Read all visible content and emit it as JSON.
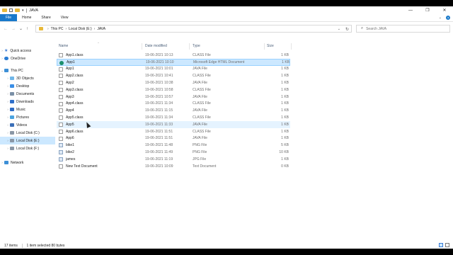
{
  "window": {
    "title": "JAVA",
    "quick_access_arrow": "▾",
    "controls": {
      "minimize": "—",
      "maximize": "❐",
      "close": "✕"
    }
  },
  "ribbon": {
    "tabs": [
      "File",
      "Home",
      "Share",
      "View"
    ],
    "expand": "⌄",
    "help": "?"
  },
  "address": {
    "crumbs": [
      "This PC",
      "Local Disk (E:)",
      "JAVA"
    ],
    "separator": "›"
  },
  "search": {
    "placeholder": "Search JAVA"
  },
  "navpane": {
    "items": [
      {
        "label": "Quick access",
        "icon": "star-icon"
      },
      {
        "label": "OneDrive",
        "icon": "cloud-icon"
      },
      {
        "label": "This PC",
        "icon": "computer-icon"
      },
      {
        "label": "3D Objects",
        "icon": "cube-icon"
      },
      {
        "label": "Desktop",
        "icon": "desktop-icon"
      },
      {
        "label": "Documents",
        "icon": "documents-icon"
      },
      {
        "label": "Downloads",
        "icon": "downloads-icon"
      },
      {
        "label": "Music",
        "icon": "music-icon"
      },
      {
        "label": "Pictures",
        "icon": "pictures-icon"
      },
      {
        "label": "Videos",
        "icon": "videos-icon"
      },
      {
        "label": "Local Disk (C:)",
        "icon": "drive-icon"
      },
      {
        "label": "Local Disk (E:)",
        "icon": "drive-icon"
      },
      {
        "label": "Local Disk (F:)",
        "icon": "drive-icon"
      },
      {
        "label": "Network",
        "icon": "network-icon"
      }
    ]
  },
  "columns": {
    "name": "Name",
    "date": "Date modified",
    "type": "Type",
    "size": "Size"
  },
  "files": [
    {
      "name": "App1.class",
      "date": "19-06-2021 10:13",
      "type": "CLASS File",
      "size": "1 KB",
      "icon": "doc"
    },
    {
      "name": "App1",
      "date": "19-06-2021 10:10",
      "type": "Microsoft Edge HTML Document",
      "size": "1 KB",
      "icon": "edge"
    },
    {
      "name": "App1",
      "date": "19-06-2021 10:01",
      "type": "JAVA File",
      "size": "1 KB",
      "icon": "java"
    },
    {
      "name": "App2.class",
      "date": "19-06-2021 10:41",
      "type": "CLASS File",
      "size": "1 KB",
      "icon": "doc"
    },
    {
      "name": "App2",
      "date": "19-06-2021 10:38",
      "type": "JAVA File",
      "size": "1 KB",
      "icon": "java"
    },
    {
      "name": "App3.class",
      "date": "19-06-2021 10:58",
      "type": "CLASS File",
      "size": "1 KB",
      "icon": "doc"
    },
    {
      "name": "App3",
      "date": "19-06-2021 10:57",
      "type": "JAVA File",
      "size": "1 KB",
      "icon": "java"
    },
    {
      "name": "App4.class",
      "date": "19-06-2021 11:34",
      "type": "CLASS File",
      "size": "1 KB",
      "icon": "doc"
    },
    {
      "name": "App4",
      "date": "19-06-2021 11:15",
      "type": "JAVA File",
      "size": "1 KB",
      "icon": "java"
    },
    {
      "name": "App5.class",
      "date": "19-06-2021 11:34",
      "type": "CLASS File",
      "size": "1 KB",
      "icon": "doc"
    },
    {
      "name": "App5",
      "date": "19-06-2021 11:33",
      "type": "JAVA File",
      "size": "1 KB",
      "icon": "java"
    },
    {
      "name": "App6.class",
      "date": "19-06-2021 11:51",
      "type": "CLASS File",
      "size": "1 KB",
      "icon": "doc"
    },
    {
      "name": "App6",
      "date": "19-06-2021 11:51",
      "type": "JAVA File",
      "size": "1 KB",
      "icon": "java"
    },
    {
      "name": "bike1",
      "date": "19-06-2021 11:48",
      "type": "PNG File",
      "size": "5 KB",
      "icon": "png"
    },
    {
      "name": "bike2",
      "date": "19-06-2021 11:49",
      "type": "PNG File",
      "size": "10 KB",
      "icon": "png"
    },
    {
      "name": "james",
      "date": "19-06-2021 11:19",
      "type": "JPG File",
      "size": "1 KB",
      "icon": "jpg"
    },
    {
      "name": "New Text Document",
      "date": "19-06-2021 10:09",
      "type": "Text Document",
      "size": "0 KB",
      "icon": "doc"
    }
  ],
  "status": {
    "count": "17 items",
    "selection": "1 item selected  80 bytes"
  }
}
